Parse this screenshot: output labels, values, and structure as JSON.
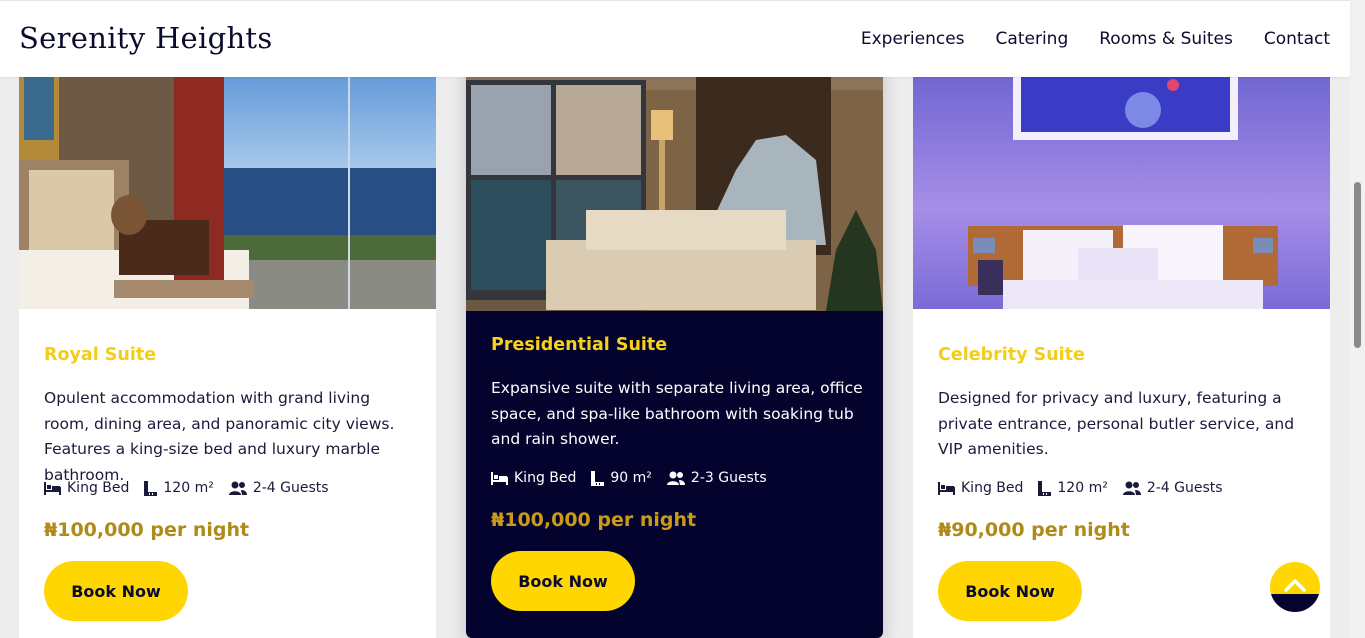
{
  "header": {
    "logo": "Serenity Heights",
    "nav": [
      "Experiences",
      "Catering",
      "Rooms & Suites",
      "Contact"
    ]
  },
  "suites": [
    {
      "title": "Royal Suite",
      "description": "Opulent accommodation with grand living room, dining area, and panoramic city views. Features a king-size bed and luxury marble bathroom.",
      "bed": "King Bed",
      "area": "120 m²",
      "guests": "2-4 Guests",
      "price": "₦100,000 per night",
      "button": "Book Now"
    },
    {
      "title": "Presidential Suite",
      "description": "Expansive suite with separate living area, office space, and spa-like bathroom with soaking tub and rain shower.",
      "bed": "King Bed",
      "area": "90 m²",
      "guests": "2-3 Guests",
      "price": "₦100,000 per night",
      "button": "Book Now"
    },
    {
      "title": "Celebrity Suite",
      "description": "Designed for privacy and luxury, featuring a private entrance, personal butler service, and VIP amenities.",
      "bed": "King Bed",
      "area": "120 m²",
      "guests": "2-4 Guests",
      "price": "₦90,000 per night",
      "button": "Book Now"
    }
  ],
  "icons": {
    "bed": "bed-icon",
    "area": "ruler-icon",
    "guests": "users-icon",
    "back_to_top": "chevron-up-icon"
  },
  "colors": {
    "accent_yellow": "#ffd600",
    "navy": "#03032e",
    "title_gold": "#f4cc1b",
    "price_gold": "#b08a19"
  }
}
